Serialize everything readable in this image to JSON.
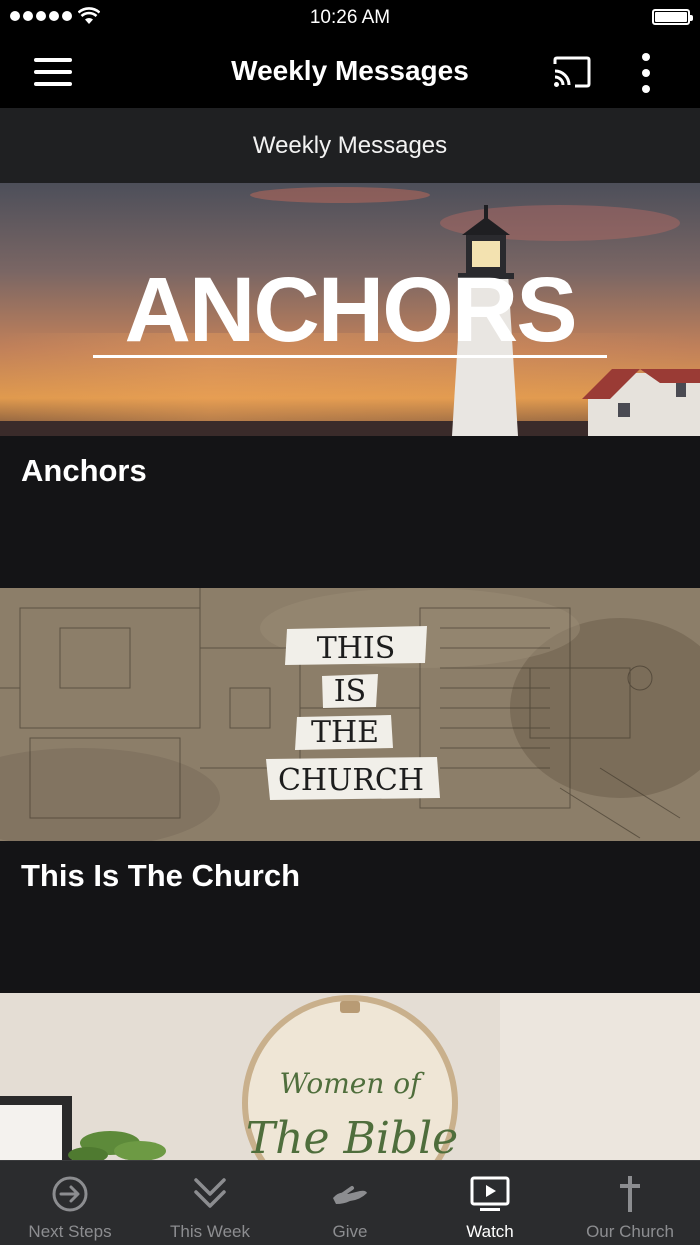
{
  "status_bar": {
    "time": "10:26 AM"
  },
  "app_bar": {
    "title": "Weekly Messages"
  },
  "subheader": "Weekly Messages",
  "messages": [
    {
      "title": "Anchors",
      "banner_text": "ANCHORS"
    },
    {
      "title": "This Is The Church",
      "banner_lines": [
        "THIS",
        "IS",
        "THE",
        "CHURCH"
      ]
    },
    {
      "title": "",
      "banner_lines": [
        "Women of",
        "The Bible"
      ]
    }
  ],
  "tabs": [
    {
      "label": "Next Steps",
      "icon": "arrow-circle-icon",
      "active": false
    },
    {
      "label": "This Week",
      "icon": "double-chevron-down-icon",
      "active": false
    },
    {
      "label": "Give",
      "icon": "give-hand-icon",
      "active": false
    },
    {
      "label": "Watch",
      "icon": "tv-play-icon",
      "active": true
    },
    {
      "label": "Our Church",
      "icon": "cross-icon",
      "active": false
    }
  ],
  "colors": {
    "background": "#141416",
    "bar": "#000000",
    "subheader": "#1f2022",
    "tabbar": "#2b2c2e",
    "tab_inactive": "#8c8d90",
    "tab_active": "#ffffff"
  }
}
